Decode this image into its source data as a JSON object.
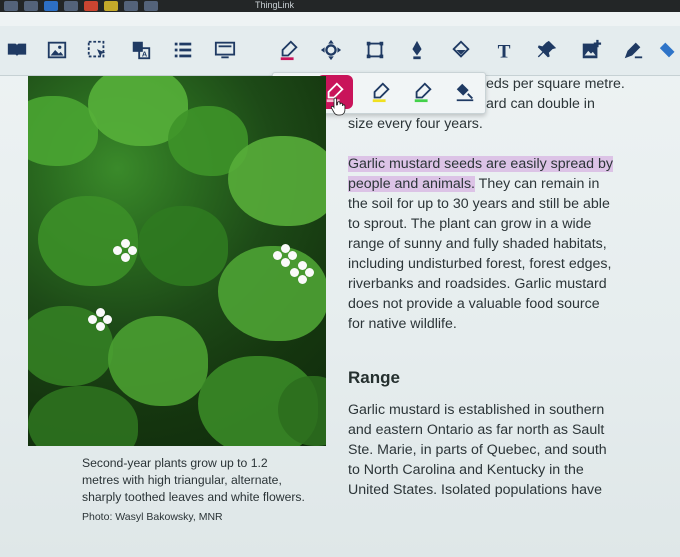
{
  "taskbar": {
    "label": "ThingLink"
  },
  "toolbar": {
    "tools": [
      "book-icon",
      "image-icon",
      "select-icon",
      "translate-icon",
      "list-icon",
      "screen-icon",
      "highlighter-icon",
      "move-icon",
      "crop-icon",
      "pen-icon",
      "fill-icon",
      "text-icon",
      "pin-icon",
      "add-image-icon",
      "write-icon",
      "eraser-icon"
    ],
    "text_tool_label": "T"
  },
  "popup": {
    "tools": [
      "cyan-highlighter",
      "pink-highlighter",
      "yellow-highlighter",
      "green-highlighter",
      "clear-highlights"
    ],
    "active": "pink-highlighter",
    "colors": {
      "cyan": "#18c6d6",
      "pink": "#c9145a",
      "yellow": "#f0e020",
      "green": "#43d14a"
    }
  },
  "image": {
    "caption_lines": [
      "Second-year plants grow up to 1.2",
      "metres with high triangular, alternate,",
      "sharply toothed leaves and white flowers."
    ],
    "credit": "Photo: Wasyl Bakowsky, MNR"
  },
  "article": {
    "partial_lines": [
      "eds per square metre.",
      "ard can double in",
      "size every four years."
    ],
    "paragraph_highlight": [
      "Garlic mustard seeds are easily spread by",
      "people and animals."
    ],
    "paragraph_rest": [
      " They can remain in",
      "the soil for up to 30 years and still be able",
      "to sprout. The plant can grow in a wide",
      "range of sunny and fully shaded habitats,",
      "including undisturbed forest, forest edges,",
      "riverbanks and roadsides. Garlic mustard",
      "does not provide a valuable food source",
      "for native wildlife."
    ],
    "heading": "Range",
    "range_lines": [
      "Garlic mustard is established in southern",
      "and eastern Ontario as far north as Sault",
      "Ste. Marie, in parts of Quebec, and south",
      "to North Carolina and Kentucky in the",
      "United States. Isolated populations have"
    ]
  }
}
